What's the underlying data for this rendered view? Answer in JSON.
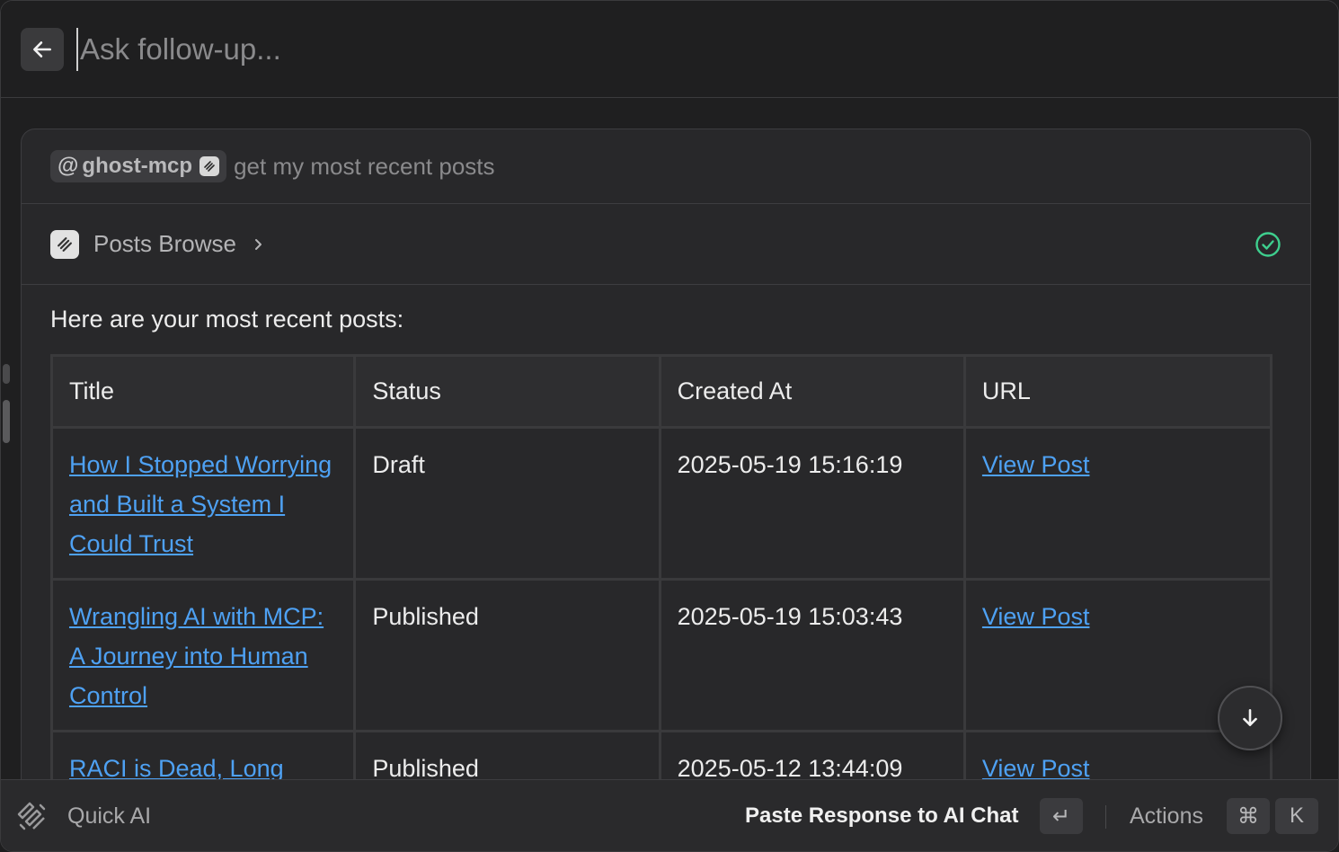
{
  "header": {
    "back_icon": "arrow-left-icon",
    "input_placeholder": "Ask follow-up...",
    "input_value": ""
  },
  "prompt": {
    "mention_at": "@",
    "mention_name": "ghost-mcp",
    "mention_icon": "ghost-logo-icon",
    "text": "get my most recent posts"
  },
  "tool": {
    "icon": "ghost-logo-icon",
    "label": "Posts Browse",
    "status_icon": "check-circle-icon",
    "status_color": "#3ecf8e"
  },
  "response": {
    "intro": "Here are your most recent posts:",
    "table": {
      "headers": [
        "Title",
        "Status",
        "Created At",
        "URL"
      ],
      "rows": [
        {
          "title": "How I Stopped Worrying and Built a System I Could Trust",
          "status": "Draft",
          "created_at": "2025-05-19 15:16:19",
          "url_label": "View Post"
        },
        {
          "title": "Wrangling AI with MCP: A Journey into Human Control",
          "status": "Published",
          "created_at": "2025-05-19 15:03:43",
          "url_label": "View Post"
        },
        {
          "title": "RACI is Dead, Long",
          "status": "Published",
          "created_at": "2025-05-12 13:44:09",
          "url_label": "View Post"
        }
      ]
    }
  },
  "scroll_button_icon": "arrow-down-icon",
  "footer": {
    "app_icon": "quick-ai-logo-icon",
    "app_name": "Quick AI",
    "primary_action": "Paste Response to AI Chat",
    "primary_key": "↵",
    "actions_label": "Actions",
    "actions_keys": [
      "⌘",
      "K"
    ]
  },
  "colors": {
    "link": "#4ea1f3",
    "success": "#3ecf8e",
    "background": "#1f1f20"
  }
}
